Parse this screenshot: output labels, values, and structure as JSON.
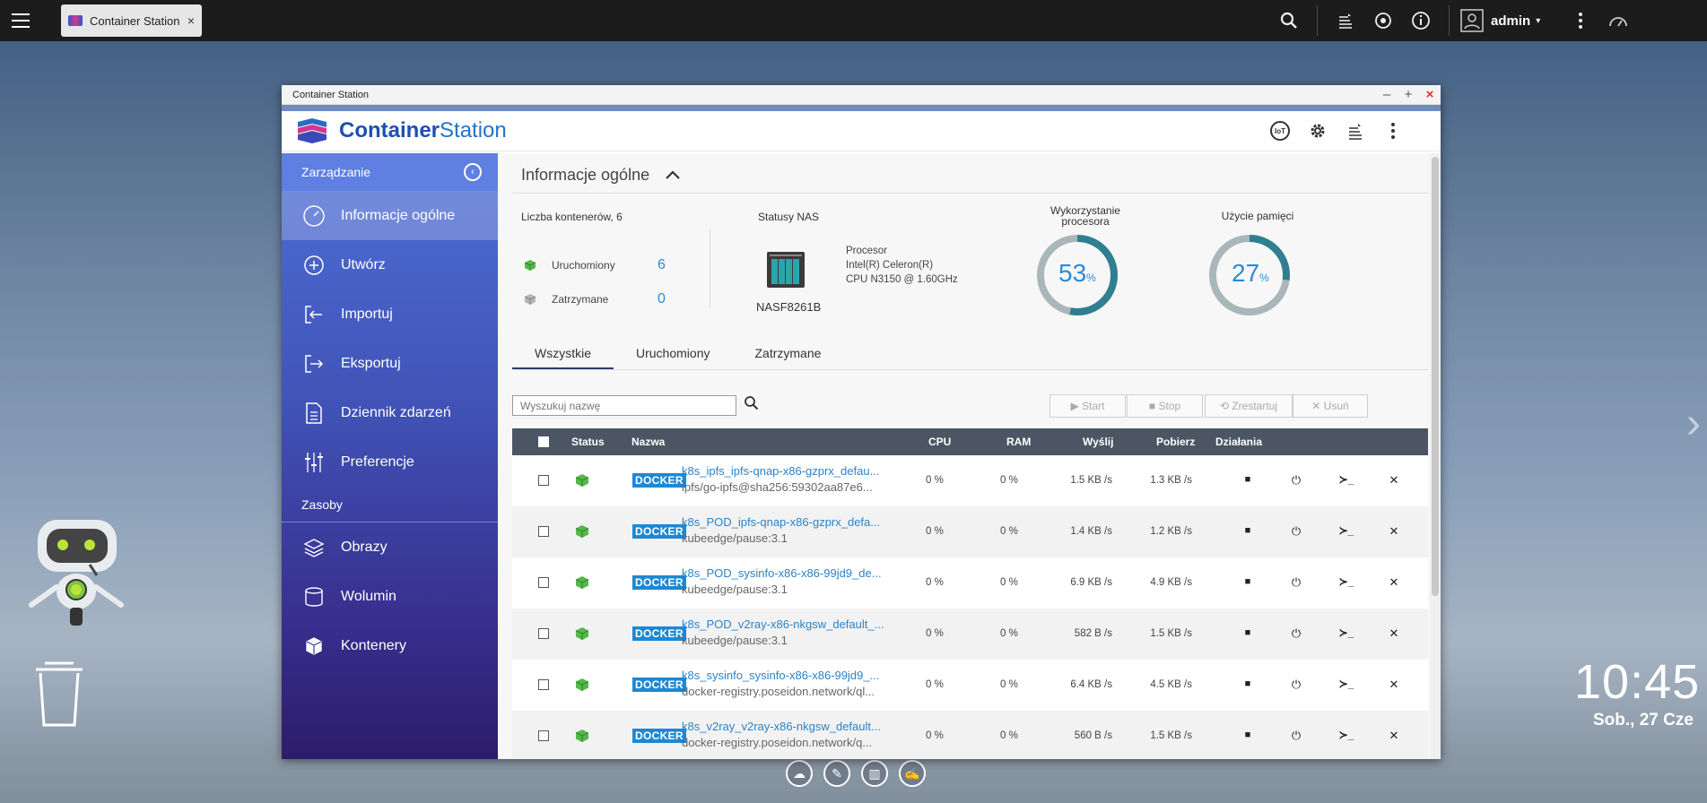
{
  "taskbar": {
    "tab_title": "Container Station",
    "tab_close": "×",
    "user": "admin",
    "user_caret": "▾"
  },
  "desktop": {
    "time": "10:45",
    "date": "Sob., 27 Cze"
  },
  "window": {
    "title": "Container Station",
    "min": "–",
    "max": "+",
    "close": "×",
    "brand_a": "Container",
    "brand_b": "Station",
    "iot": "IoT"
  },
  "sidebar": {
    "header": "Zarządzanie",
    "collapse_icon": "‹",
    "items": [
      {
        "label": "Informacje ogólne",
        "icon": "gauge-icon"
      },
      {
        "label": "Utwórz",
        "icon": "plus-icon"
      },
      {
        "label": "Importuj",
        "icon": "import-icon"
      },
      {
        "label": "Eksportuj",
        "icon": "export-icon"
      },
      {
        "label": "Dziennik zdarzeń",
        "icon": "log-icon"
      },
      {
        "label": "Preferencje",
        "icon": "sliders-icon"
      }
    ],
    "section": "Zasoby",
    "resources": [
      {
        "label": "Obrazy",
        "icon": "layers-icon"
      },
      {
        "label": "Wolumin",
        "icon": "cylinder-icon"
      },
      {
        "label": "Kontenery",
        "icon": "cube-icon"
      }
    ]
  },
  "overview": {
    "title": "Informacje ogólne",
    "count_label": "Liczba kontenerów, 6",
    "running_label": "Uruchomiony",
    "running_count": "6",
    "stopped_label": "Zatrzymane",
    "stopped_count": "0",
    "nas_label": "Statusy NAS",
    "nas_name": "NASF8261B",
    "cpu_title": "Procesor",
    "cpu_line1": "Intel(R) Celeron(R)",
    "cpu_line2": "CPU N3150 @ 1.60GHz",
    "cpu_usage_label_1": "Wykorzystanie",
    "cpu_usage_label_2": "procesora",
    "cpu_usage": 53,
    "cpu_usage_text": "53",
    "mem_usage_label": "Użycie pamięci",
    "mem_usage": 27,
    "mem_usage_text": "27",
    "percent": "%",
    "colors": {
      "gauge_fill": "#2f7f90",
      "gauge_track": "#a9b7ba",
      "accent": "#2b8bd6"
    }
  },
  "tabs": [
    "Wszystkie",
    "Uruchomiony",
    "Zatrzymane"
  ],
  "toolbar": {
    "search_placeholder": "Wyszukuj nazwę",
    "start": "▶ Start",
    "stop": "■ Stop",
    "restart": "⟲ Zrestartuj",
    "remove": "✕ Usuń"
  },
  "table": {
    "headers": {
      "status": "Status",
      "name": "Nazwa",
      "cpu": "CPU",
      "ram": "RAM",
      "send": "Wyślij",
      "recv": "Pobierz",
      "actions": "Działania"
    },
    "badge": "DOCKER",
    "rows": [
      {
        "name": "k8s_ipfs_ipfs-qnap-x86-gzprx_defau...",
        "image": "ipfs/go-ipfs@sha256:59302aa87e6...",
        "cpu": "0 %",
        "ram": "0 %",
        "send": "1.5 KB /s",
        "recv": "1.3 KB /s"
      },
      {
        "name": "k8s_POD_ipfs-qnap-x86-gzprx_defa...",
        "image": "kubeedge/pause:3.1",
        "cpu": "0 %",
        "ram": "0 %",
        "send": "1.4 KB /s",
        "recv": "1.2 KB /s"
      },
      {
        "name": "k8s_POD_sysinfo-x86-x86-99jd9_de...",
        "image": "kubeedge/pause:3.1",
        "cpu": "0 %",
        "ram": "0 %",
        "send": "6.9 KB /s",
        "recv": "4.9 KB /s"
      },
      {
        "name": "k8s_POD_v2ray-x86-nkgsw_default_...",
        "image": "kubeedge/pause:3.1",
        "cpu": "0 %",
        "ram": "0 %",
        "send": "582 B /s",
        "recv": "1.5 KB /s"
      },
      {
        "name": "k8s_sysinfo_sysinfo-x86-x86-99jd9_...",
        "image": "docker-registry.poseidon.network/ql...",
        "cpu": "0 %",
        "ram": "0 %",
        "send": "6.4 KB /s",
        "recv": "4.5 KB /s"
      },
      {
        "name": "k8s_v2ray_v2ray-x86-nkgsw_default...",
        "image": "docker-registry.poseidon.network/q...",
        "cpu": "0 %",
        "ram": "0 %",
        "send": "560 B /s",
        "recv": "1.5 KB /s"
      }
    ],
    "action_glyphs": {
      "stop": "■",
      "restart": "⏻",
      "console": "≻_",
      "remove": "✕"
    }
  }
}
